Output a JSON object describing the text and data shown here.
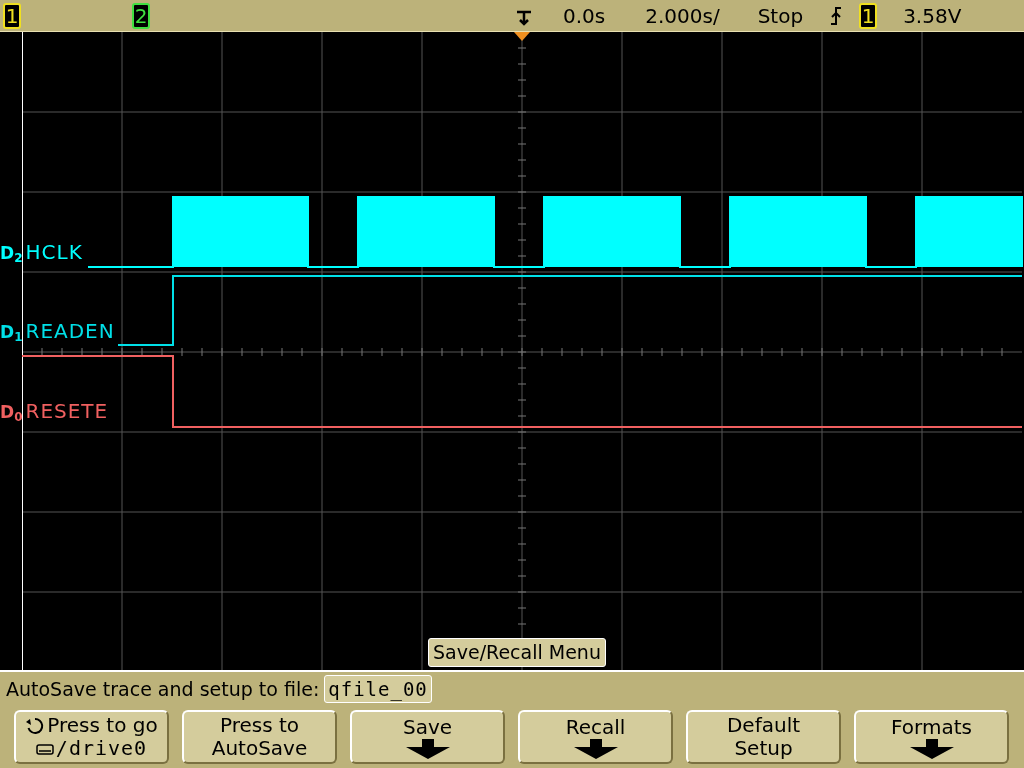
{
  "status_bar": {
    "channel_badges": [
      {
        "label": "1",
        "color": "#f0e020"
      },
      {
        "label": "2",
        "color": "#40e040"
      }
    ],
    "delay": "0.0s",
    "timebase": "2.000s/",
    "run_state": "Stop",
    "trigger_source": {
      "label": "1",
      "color": "#f0e020"
    },
    "trigger_level": "3.58V"
  },
  "channels": [
    {
      "id": "D$_{2}$",
      "name": "HCLK",
      "color": "#00ffff"
    },
    {
      "id": "D$_{1}$",
      "name": "READEN",
      "color": "#00e0e8"
    },
    {
      "id": "D$_{0}$",
      "name": "RESETE",
      "color": "#f06060"
    }
  ],
  "menu_title": "Save/Recall Menu",
  "autosave": {
    "label": "AutoSave trace and setup to file:",
    "value": "qfile_00"
  },
  "softkeys": [
    {
      "kind": "go",
      "lines": [
        "Press to go",
        "/drive0"
      ]
    },
    {
      "kind": "text",
      "lines": [
        "Press to",
        "AutoSave"
      ]
    },
    {
      "kind": "submenu",
      "lines": [
        "Save"
      ]
    },
    {
      "kind": "submenu",
      "lines": [
        "Recall"
      ]
    },
    {
      "kind": "text",
      "lines": [
        "Default",
        "Setup"
      ]
    },
    {
      "kind": "submenu",
      "lines": [
        "Formats"
      ]
    }
  ]
}
